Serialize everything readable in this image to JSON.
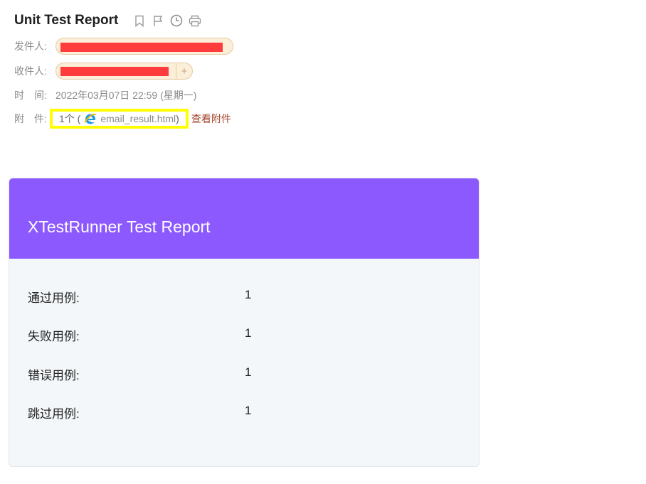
{
  "header": {
    "title": "Unit Test Report",
    "icons": [
      "bookmark-icon",
      "flag-icon",
      "clock-icon",
      "print-icon"
    ]
  },
  "meta": {
    "from_label": "发件人:",
    "to_label": "收件人:",
    "time_label": "时　间:",
    "time_value": "2022年03月07日 22:59 (星期一)",
    "attach_label": "附　件:",
    "attach_count": "1个 (",
    "attach_filename": "email_result.html",
    "attach_close": " )",
    "view_attachment": "查看附件"
  },
  "report": {
    "title": "XTestRunner Test Report",
    "rows": [
      {
        "label": "通过用例:",
        "value": "1"
      },
      {
        "label": "失败用例:",
        "value": "1"
      },
      {
        "label": "错误用例:",
        "value": "1"
      },
      {
        "label": "跳过用例:",
        "value": "1"
      }
    ]
  },
  "colors": {
    "header_bg": "#8c59ff",
    "highlight": "#ffff00",
    "redaction": "#ff3b3b",
    "link": "#a5442c"
  }
}
